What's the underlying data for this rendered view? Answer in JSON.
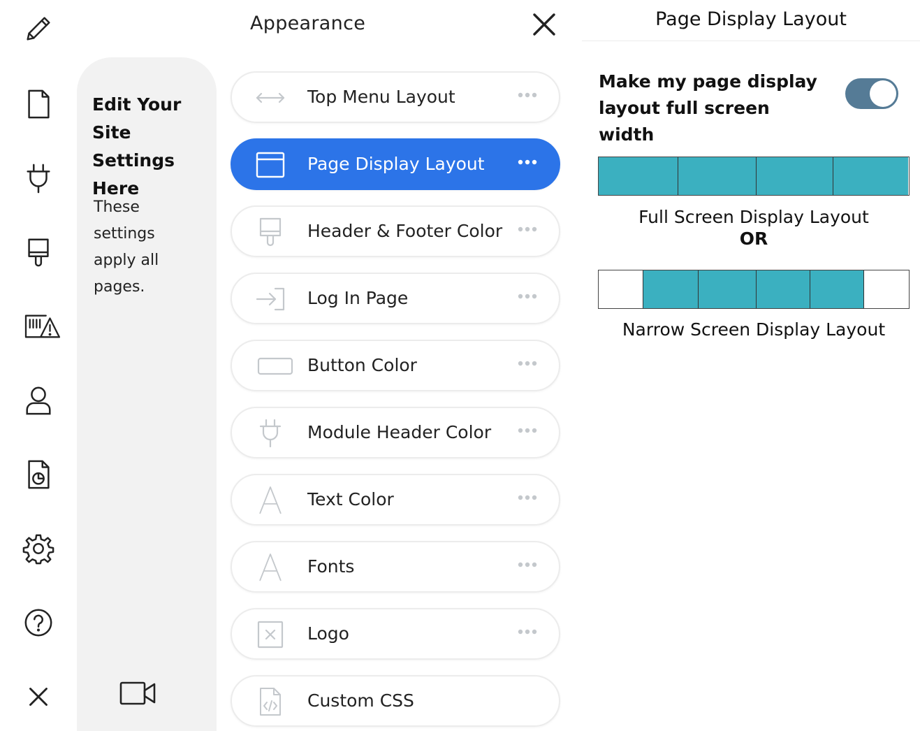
{
  "colors": {
    "accent": "#2c74e8",
    "teal": "#3bb0c0",
    "toggle_on": "#557b96",
    "icon_gray": "#c4c8cc",
    "dark": "#222222"
  },
  "rail": {
    "items": [
      {
        "icon": "pencil-icon"
      },
      {
        "icon": "page-icon"
      },
      {
        "icon": "plug-icon"
      },
      {
        "icon": "paint-brush-icon"
      },
      {
        "icon": "barcode-alert-icon"
      },
      {
        "icon": "user-icon"
      },
      {
        "icon": "report-chart-icon"
      },
      {
        "icon": "gear-icon"
      },
      {
        "icon": "help-icon"
      },
      {
        "icon": "close-icon"
      }
    ]
  },
  "info": {
    "title": "Edit Your Site Settings Here",
    "text": "These settings apply all pages."
  },
  "menu": {
    "title": "Appearance",
    "items": [
      {
        "label": "Top Menu Layout",
        "icon": "horizontal-arrows-icon",
        "active": false
      },
      {
        "label": "Page Display Layout",
        "icon": "browser-window-icon",
        "active": true
      },
      {
        "label": "Header & Footer Color",
        "icon": "paint-brush-icon",
        "active": false
      },
      {
        "label": "Log In Page",
        "icon": "login-icon",
        "active": false
      },
      {
        "label": "Button Color",
        "icon": "button-shape-icon",
        "active": false
      },
      {
        "label": "Module Header Color",
        "icon": "plug-icon",
        "active": false
      },
      {
        "label": "Text Color",
        "icon": "letter-a-icon",
        "active": false
      },
      {
        "label": "Fonts",
        "icon": "letter-a-icon",
        "active": false
      },
      {
        "label": "Logo",
        "icon": "image-placeholder-icon",
        "active": false
      },
      {
        "label": "Custom CSS",
        "icon": "code-file-icon",
        "active": false
      }
    ]
  },
  "right": {
    "title": "Page Display Layout",
    "question": "Make my page display layout full screen width",
    "toggle_on": true,
    "full_caption": "Full Screen Display Layout",
    "or_label": "OR",
    "narrow_caption": "Narrow Screen Display Layout"
  }
}
